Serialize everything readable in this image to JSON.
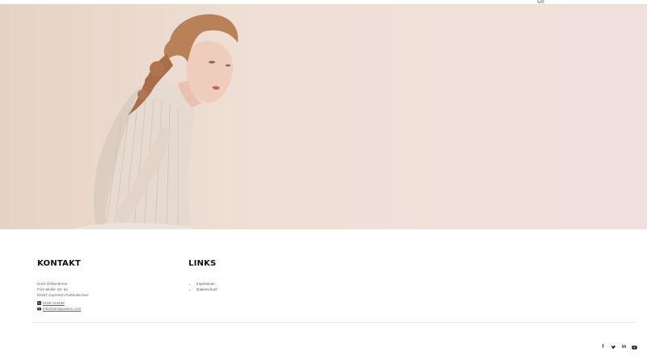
{
  "footer": {
    "contact": {
      "title": "KONTAKT",
      "address": [
        "Doris Dößenbener",
        "Fritz-Müller-Str. 54",
        "82467 Garmisch-Partenkirchen"
      ],
      "phone": "0189 123456",
      "email": "info@windpassion.com"
    },
    "links": {
      "title": "LINKS",
      "items": [
        "Impressum",
        "Datenschutz"
      ]
    }
  },
  "social_icons": [
    "facebook-icon",
    "twitter-icon",
    "linkedin-icon",
    "youtube-icon"
  ]
}
